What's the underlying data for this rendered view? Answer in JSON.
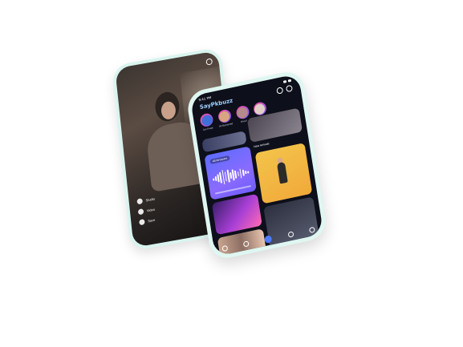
{
  "front_phone": {
    "status_time": "9:41 PM",
    "app_name": "SayPkbuzz",
    "section_label": "New Arrivals",
    "audio_label": "All Airwaves",
    "stories": [
      {
        "name": "Jan Kwak",
        "color": "#3f6fd8"
      },
      {
        "name": "Ali Mohamed",
        "color": "#d8a57f"
      },
      {
        "name": "Nsoul",
        "color": "#b58a8a"
      },
      {
        "name": "Mia Mafara",
        "color": "#e0cfc6"
      }
    ],
    "icons": {
      "header": [
        "search-icon",
        "bell-icon"
      ],
      "nav": [
        "home-icon",
        "search-icon",
        "create-icon",
        "chat-icon",
        "profile-icon"
      ]
    }
  },
  "back_phone": {
    "actions": [
      {
        "label": "Studio"
      },
      {
        "label": "Video"
      },
      {
        "label": "Save"
      }
    ],
    "icons": [
      "back-icon",
      "more-icon"
    ]
  },
  "colors": {
    "accent": "#4f7bff",
    "frame": "#dff6f1",
    "screen_bg": "#0d0f1a"
  },
  "wave": [
    3,
    6,
    10,
    14,
    18,
    12,
    16,
    8,
    14,
    10,
    6,
    12,
    8,
    4,
    3
  ]
}
